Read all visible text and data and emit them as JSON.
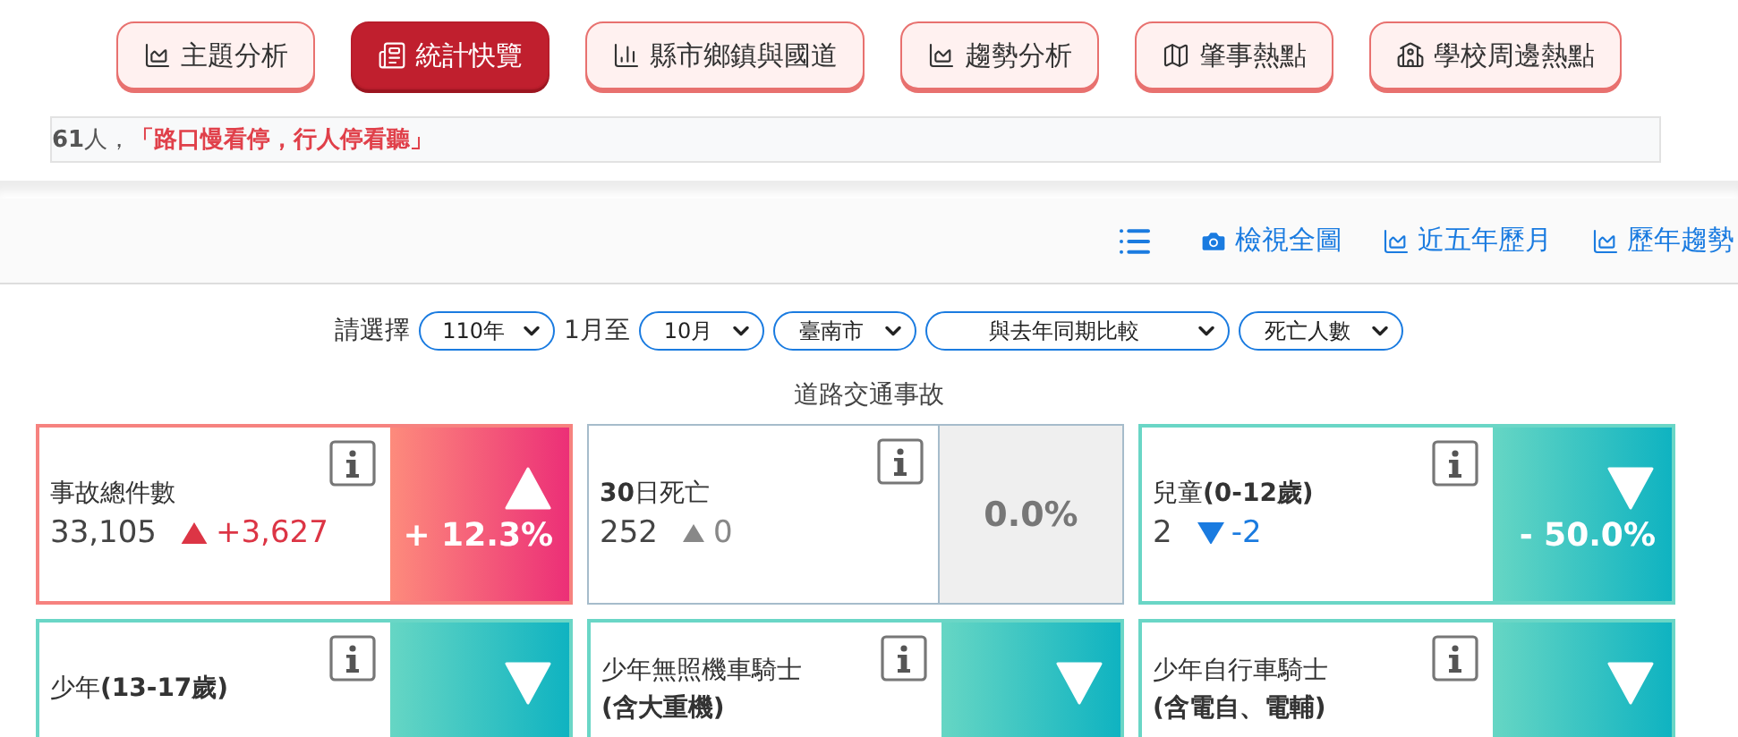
{
  "nav": [
    {
      "label": "主題分析",
      "selected": false
    },
    {
      "label": "統計快覽",
      "selected": true
    },
    {
      "label": "縣市鄉鎮與國道",
      "selected": false
    },
    {
      "label": "趨勢分析",
      "selected": false
    },
    {
      "label": "肇事熱點",
      "selected": false
    },
    {
      "label": "學校周邊熱點",
      "selected": false
    }
  ],
  "banner": {
    "lead": "**61**人，",
    "slogan": "「路口慢看停，行人停看聽」"
  },
  "toolbar": [
    "檢視全圖",
    "近五年歷月",
    "歷年趨勢"
  ],
  "filters": {
    "prompt": "請選擇",
    "year": "110年",
    "from_text": "1月至",
    "month": "10月",
    "city": "臺南市",
    "compare": "與去年同期比較",
    "metric": "死亡人數"
  },
  "section_title": "道路交通事故",
  "cards": [
    {
      "title_lines": [
        "事故總件數"
      ],
      "value": "33,105",
      "delta": "+3,627",
      "kind": "up",
      "percent": "+ 12.3%"
    },
    {
      "title_lines": [
        "**30**日死亡"
      ],
      "value": "252",
      "delta": "0",
      "kind": "flat",
      "percent": "0.0%"
    },
    {
      "title_lines": [
        "兒童**(0-12歲)**"
      ],
      "value": "2",
      "delta": "-2",
      "kind": "down",
      "percent": "- 50.0%"
    },
    {
      "title_lines": [
        "少年**(13-17歲)**"
      ],
      "kind": "down"
    },
    {
      "title_lines": [
        "少年無照機車騎士",
        "**(含大重機)**"
      ],
      "kind": "down"
    },
    {
      "title_lines": [
        "少年自行車騎士",
        "**(含電自、電輔)**"
      ],
      "kind": "down"
    }
  ]
}
